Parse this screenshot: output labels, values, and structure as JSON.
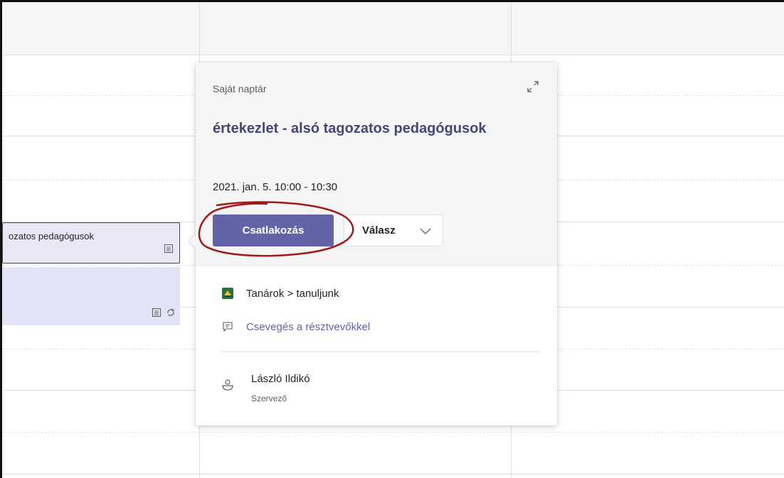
{
  "background_event": {
    "title": "ozatos pedagógusok"
  },
  "popup": {
    "calendar_name": "Saját naptár",
    "meeting_title": "értekezlet - alsó tagozatos pedagógusok",
    "meeting_time": "2021. jan. 5. 10:00 - 10:30",
    "join_label": "Csatlakozás",
    "reply_label": "Válasz",
    "channel": "Tanárok > tanuljunk",
    "chat_link": "Csevegés a résztvevőkkel",
    "organizer_name": "László Ildikó",
    "organizer_role": "Szervező"
  },
  "icons": {
    "expand": "expand-icon",
    "chevron": "chevron-down-icon",
    "team": "team-avatar-icon",
    "chat": "chat-icon",
    "person": "person-icon",
    "event": "event-icon",
    "recurring": "recurring-icon"
  },
  "colors": {
    "accent": "#6264a7",
    "title": "#464775",
    "annotation": "#a01818"
  }
}
